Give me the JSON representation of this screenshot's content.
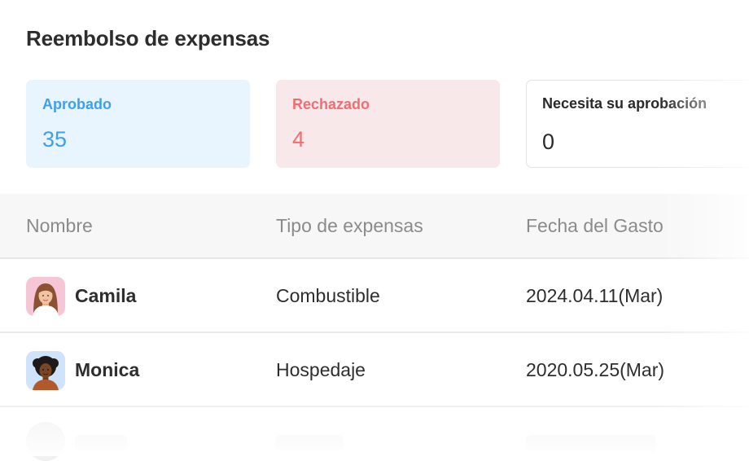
{
  "header": {
    "title": "Reembolso de expensas"
  },
  "summary": {
    "approved": {
      "label": "Aprobado",
      "value": "35",
      "color": "#3d9ff2"
    },
    "rejected": {
      "label": "Rechazado",
      "value": "4",
      "color": "#f06e72"
    },
    "pending": {
      "label": "Necesita su aprobación",
      "value": "0"
    }
  },
  "table": {
    "columns": [
      "Nombre",
      "Tipo de expensas",
      "Fecha del Gasto"
    ],
    "rows": [
      {
        "name": "Camila",
        "type": "Combustible",
        "date": "2024.04.11(Mar)",
        "avatar_icon": "woman-avatar-icon"
      },
      {
        "name": "Monica",
        "type": "Hospedaje",
        "date": "2020.05.25(Mar)",
        "avatar_icon": "woman-avatar-icon"
      }
    ]
  }
}
